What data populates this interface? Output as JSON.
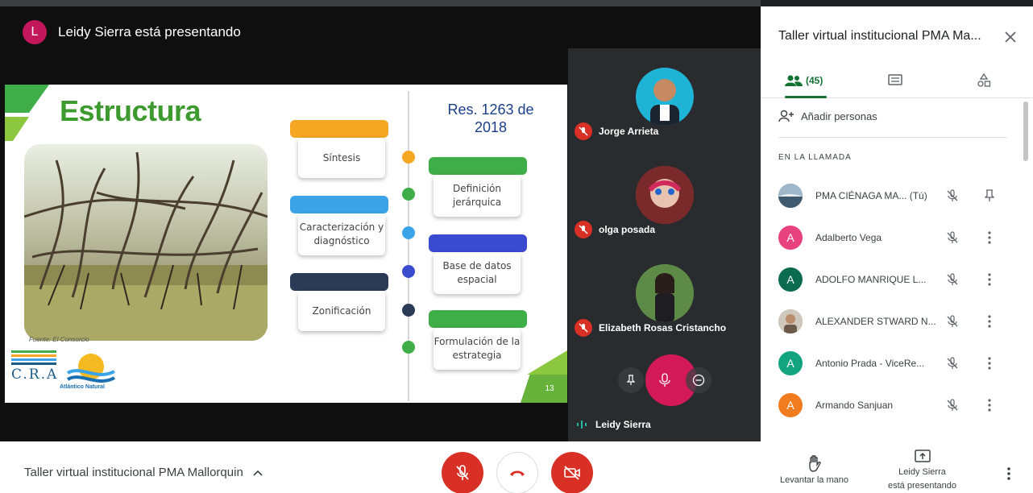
{
  "presenter": {
    "initial": "L",
    "text": "Leidy Sierra está presentando"
  },
  "slide": {
    "title": "Estructura",
    "resolution": "Res. 1263 de 2018",
    "photo_source": "Fuente: El Consorcio",
    "page_number": "13",
    "logo_cra": "C.R.A",
    "logo_atlantico": "Atlántico Natural",
    "left_items": [
      "Síntesis",
      "Caracterización y diagnóstico",
      "Zonificación"
    ],
    "right_items": [
      "Definición jerárquica",
      "Base de datos espacial",
      "Formulación de la estrategia"
    ],
    "colors": {
      "title": "#3c9a2e",
      "yellow": "#f5a623",
      "blue": "#3ba3e8",
      "navy": "#2b3a55",
      "green": "#3fae49"
    }
  },
  "tiles": [
    {
      "name": "Jorge Arrieta"
    },
    {
      "name": "olga posada"
    },
    {
      "name": "Elizabeth Rosas Cristancho"
    }
  ],
  "self_tile": {
    "name": "Leidy Sierra"
  },
  "panel": {
    "title": "Taller virtual institucional PMA Ma...",
    "people_count": "(45)",
    "add_people": "Añadir personas",
    "section_label": "EN LA LLAMADA",
    "participants": [
      {
        "name": "PMA CIÉNAGA MA...  (Tú)",
        "initial": "",
        "color": "#6b8fa8"
      },
      {
        "name": "Adalberto Vega",
        "initial": "A",
        "color": "#e8427c"
      },
      {
        "name": "ADOLFO MANRIQUE L...",
        "initial": "A",
        "color": "#0b6b4f"
      },
      {
        "name": "ALEXANDER STWARD N...",
        "initial": "",
        "color": "#a88a6a"
      },
      {
        "name": "Antonio Prada - ViceRe...",
        "initial": "A",
        "color": "#12a37f"
      },
      {
        "name": "Armando Sanjuan",
        "initial": "A",
        "color": "#f07c1f"
      }
    ]
  },
  "bottom": {
    "meeting_title": "Taller virtual institucional PMA Mallorquin",
    "raise_hand": "Levantar la mano",
    "presenting_line1": "Leidy Sierra",
    "presenting_line2": "está presentando"
  }
}
